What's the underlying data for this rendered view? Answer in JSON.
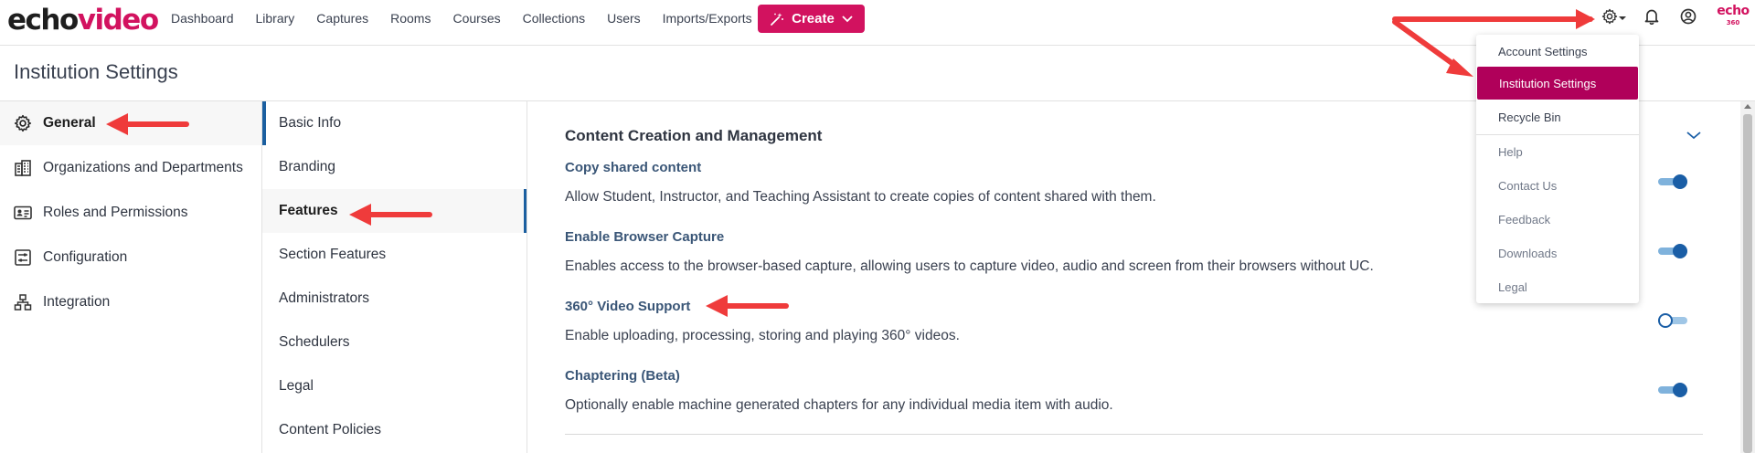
{
  "app": {
    "logo_left": "echo",
    "logo_right": "video",
    "brand_small_top": "echo",
    "brand_small_bottom": "360"
  },
  "nav": {
    "items": [
      "Dashboard",
      "Library",
      "Captures",
      "Rooms",
      "Courses",
      "Collections",
      "Users",
      "Imports/Exports"
    ],
    "create_label": "Create"
  },
  "icons": {
    "settings": "gear-icon",
    "notifications": "bell-icon",
    "account": "user-circle-icon"
  },
  "page": {
    "title": "Institution Settings"
  },
  "sidebar": {
    "items": [
      {
        "label": "General",
        "icon": "gear-icon",
        "active": true
      },
      {
        "label": "Organizations and Departments",
        "icon": "building-icon",
        "active": false
      },
      {
        "label": "Roles and Permissions",
        "icon": "id-card-icon",
        "active": false
      },
      {
        "label": "Configuration",
        "icon": "sliders-icon",
        "active": false
      },
      {
        "label": "Integration",
        "icon": "network-icon",
        "active": false
      }
    ]
  },
  "subnav": {
    "items": [
      "Basic Info",
      "Branding",
      "Features",
      "Section Features",
      "Administrators",
      "Schedulers",
      "Legal",
      "Content Policies"
    ],
    "active": "Features"
  },
  "main": {
    "section_title": "Content Creation and Management",
    "features": [
      {
        "title": "Copy shared content",
        "description": "Allow Student, Instructor, and Teaching Assistant to create copies of content shared with them.",
        "enabled": true
      },
      {
        "title": "Enable Browser Capture",
        "description": "Enables access to the browser-based capture, allowing users to capture video, audio and screen from their browsers without UC.",
        "enabled": true
      },
      {
        "title": "360° Video Support",
        "description": "Enable uploading, processing, storing and playing 360° videos.",
        "enabled": false
      },
      {
        "title": "Chaptering (Beta)",
        "description": "Optionally enable machine generated chapters for any individual media item with audio.",
        "enabled": true
      }
    ]
  },
  "dropdown": {
    "items": [
      "Account Settings",
      "Institution Settings",
      "Recycle Bin",
      "Help",
      "Contact Us",
      "Feedback",
      "Downloads",
      "Legal"
    ],
    "active": "Institution Settings"
  },
  "colors": {
    "brand": "#d2125f",
    "menu_active": "#b0005a",
    "accent_blue": "#1a5ea6",
    "annotation_arrow": "#ef3b3b"
  }
}
